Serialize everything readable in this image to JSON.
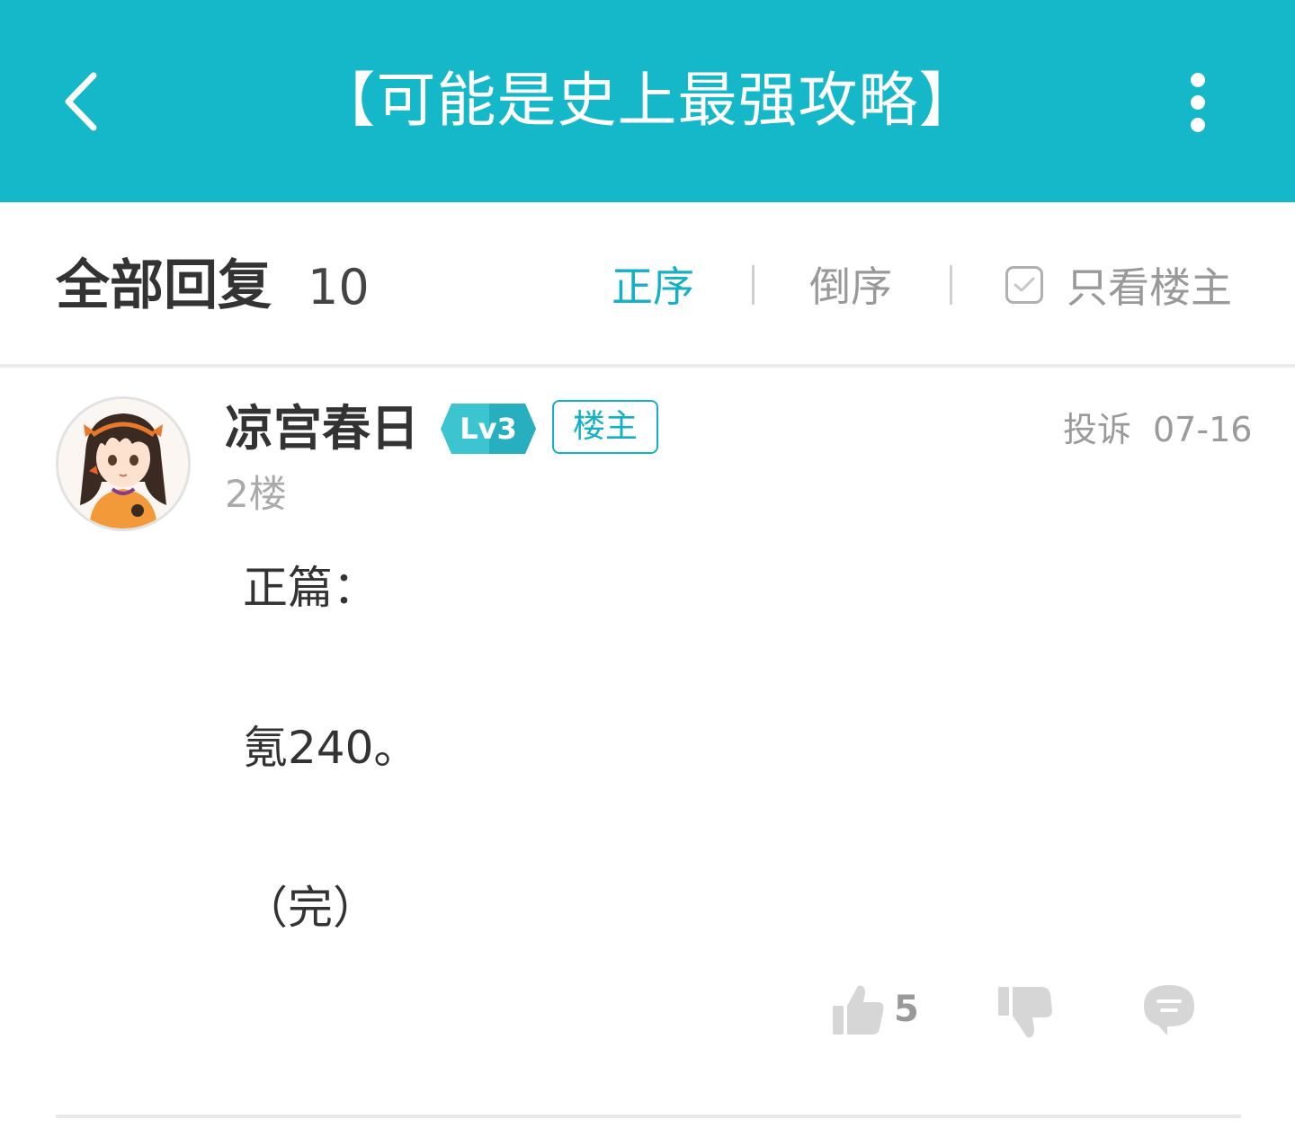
{
  "header": {
    "title": "【可能是史上最强攻略】",
    "back_icon": "chevron-left-icon",
    "more_icon": "more-vertical-icon",
    "background": "#14b8c8"
  },
  "replies_bar": {
    "title": "全部回复",
    "count": "10",
    "sort_ascending": "正序",
    "sort_descending": "倒序",
    "op_only_label": "只看楼主",
    "op_only_checked": true,
    "accent_color": "#14b0c4"
  },
  "post": {
    "username": "凉宫春日",
    "level": "Lv3",
    "op_badge": "楼主",
    "floor": "2楼",
    "report": "投诉",
    "date": "07-16",
    "content": [
      "正篇：",
      "氪240。",
      "（完）"
    ],
    "likes": "5"
  }
}
